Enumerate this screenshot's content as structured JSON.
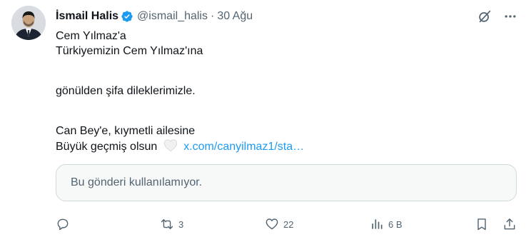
{
  "author": {
    "name": "İsmail Halis",
    "handle": "@ismail_halis",
    "separator": "·",
    "date": "30 Ağu"
  },
  "tweet": {
    "lines": [
      "Cem Yılmaz'a",
      "Türkiyemizin Cem Yılmaz'ına",
      "gönülden şifa dileklerimizle.",
      "Can Bey'e, kıymetli ailesine",
      "Büyük geçmiş olsun"
    ],
    "link_text": "x.com/canyilmaz1/sta…",
    "emoji": "white-heart"
  },
  "quoted": {
    "unavailable_text": "Bu gönderi kullanılamıyor."
  },
  "actions": {
    "reply_count": "",
    "retweet_count": "3",
    "like_count": "22",
    "views_count": "6 B"
  },
  "colors": {
    "verified": "#1d9bf0",
    "link": "#1d9bf0",
    "muted": "#536471",
    "text": "#0f1419",
    "border": "#cfd9de"
  }
}
